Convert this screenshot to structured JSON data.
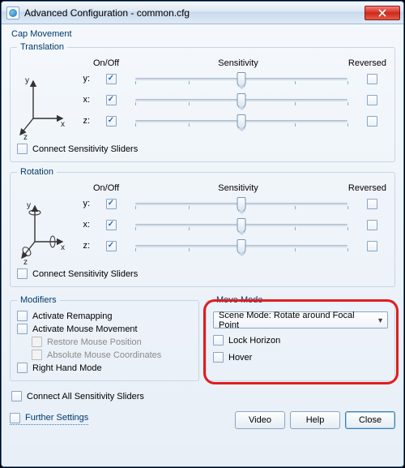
{
  "window": {
    "title": "Advanced Configuration - common.cfg"
  },
  "cap_movement": {
    "title": "Cap Movement"
  },
  "translation": {
    "legend": "Translation",
    "header": {
      "onoff": "On/Off",
      "sensitivity": "Sensitivity",
      "reversed": "Reversed"
    },
    "axes": [
      {
        "label": "y:",
        "onoff": true,
        "reversed": false,
        "sensitivity": 50
      },
      {
        "label": "x:",
        "onoff": true,
        "reversed": false,
        "sensitivity": 50
      },
      {
        "label": "z:",
        "onoff": true,
        "reversed": false,
        "sensitivity": 50
      }
    ],
    "connect_label": "Connect Sensitivity Sliders",
    "connect": false
  },
  "rotation": {
    "legend": "Rotation",
    "header": {
      "onoff": "On/Off",
      "sensitivity": "Sensitivity",
      "reversed": "Reversed"
    },
    "axes": [
      {
        "label": "y:",
        "onoff": true,
        "reversed": false,
        "sensitivity": 50
      },
      {
        "label": "x:",
        "onoff": true,
        "reversed": false,
        "sensitivity": 50
      },
      {
        "label": "z:",
        "onoff": true,
        "reversed": false,
        "sensitivity": 50
      }
    ],
    "connect_label": "Connect Sensitivity Sliders",
    "connect": false
  },
  "modifiers": {
    "legend": "Modifiers",
    "activate_remapping": {
      "label": "Activate Remapping",
      "checked": false
    },
    "activate_mouse": {
      "label": "Activate Mouse Movement",
      "checked": false
    },
    "restore_mouse": {
      "label": "Restore Mouse Position",
      "checked": false
    },
    "abs_mouse": {
      "label": "Absolute Mouse Coordinates",
      "checked": false
    },
    "right_hand": {
      "label": "Right Hand Mode",
      "checked": false
    }
  },
  "move_mode": {
    "legend": "Move Mode",
    "selected": "Scene Mode: Rotate around Focal Point",
    "lock_horizon": {
      "label": "Lock Horizon",
      "checked": false
    },
    "hover": {
      "label": "Hover",
      "checked": false
    }
  },
  "connect_all": {
    "label": "Connect All Sensitivity Sliders",
    "checked": false
  },
  "further": {
    "label": "Further Settings",
    "checked": false
  },
  "buttons": {
    "video": "Video",
    "help": "Help",
    "close": "Close"
  }
}
